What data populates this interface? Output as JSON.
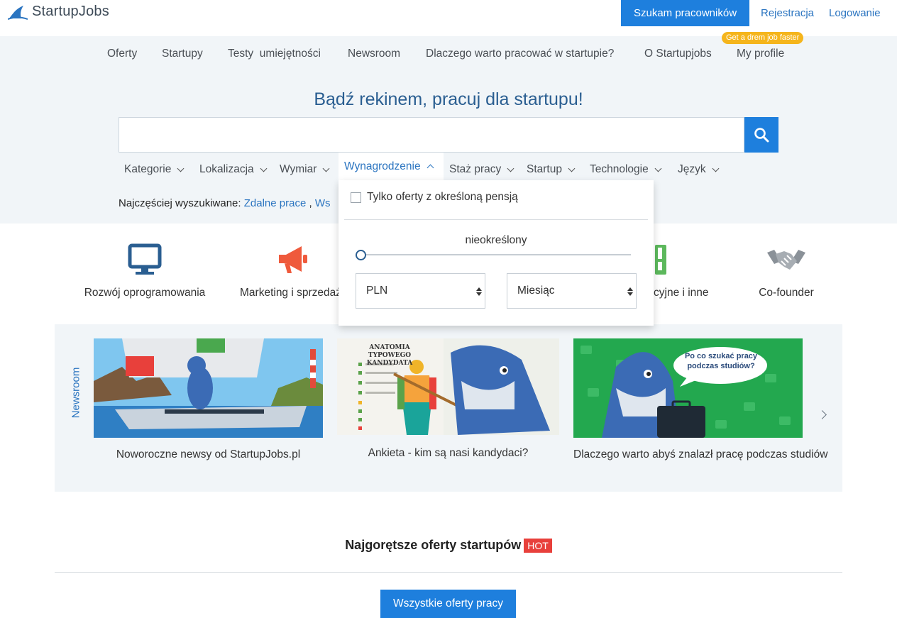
{
  "header": {
    "logo_text": "StartupJobs",
    "employer_button": "Szukam pracowników",
    "register_link": "Rejestracja",
    "login_link": "Logowanie"
  },
  "nav": {
    "items": [
      "Oferty",
      "Startupy",
      "Testy  umiejętności",
      "Newsroom",
      "Dlaczego warto pracować w startupie?",
      "O Startupjobs",
      "My profile"
    ],
    "profile_badge": "Get a drem job faster"
  },
  "hero": {
    "title": "Bądź rekinem, pracuj dla startupu!",
    "search_value": ""
  },
  "filters": [
    "Kategorie",
    "Lokalizacja",
    "Wymiar",
    "Wynagrodzenie",
    "Staż pracy",
    "Startup",
    "Technologie",
    "Język"
  ],
  "popular": {
    "label": "Najczęściej wyszukiwane:",
    "link1": "Zdalne prace",
    "sep": " , ",
    "link2": "Ws"
  },
  "salary_dropdown": {
    "checkbox_label": "Tylko oferty z określoną pensją",
    "range_label": "nieokreślony",
    "slider_fraction": 0,
    "currency": "PLN",
    "period": "Miesiąc"
  },
  "categories": [
    {
      "label": "Rozwój oprogramowania",
      "icon": "monitor-icon",
      "color": "#2a5e91"
    },
    {
      "label": "Marketing i sprzedaż",
      "icon": "megaphone-icon",
      "color": "#ef5a3c"
    },
    {
      "label": "cyjne i inne",
      "icon": "binder-icon",
      "color": "#5cb85c"
    },
    {
      "label": "Co-founder",
      "icon": "handshake-icon",
      "color": "#8a9198"
    }
  ],
  "newsroom": {
    "label": "Newsroom",
    "cards": [
      {
        "caption": "Noworoczne newsy od StartupJobs.pl"
      },
      {
        "caption": "Ankieta - kim są nasi kandydaci?",
        "image_heading": "ANATOMIA TYPOWEGO KANDYDATA"
      },
      {
        "caption": "Dlaczego warto abyś znalazł pracę podczas studiów",
        "image_bubble": "Po co szukać pracy podczas studiów?"
      }
    ]
  },
  "hot": {
    "title": "Najgorętsze oferty startupów",
    "badge": "HOT",
    "all_offers_button": "Wszystkie oferty pracy"
  }
}
